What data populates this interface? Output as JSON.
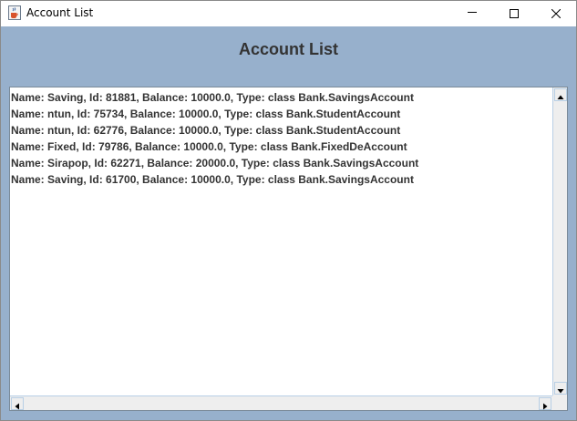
{
  "window": {
    "title": "Account List",
    "icon": "java-cup-icon",
    "controls": [
      "minimize",
      "maximize",
      "close"
    ]
  },
  "main": {
    "heading": "Account List",
    "accounts": [
      "Name: Saving, Id: 81881, Balance: 10000.0, Type: class Bank.SavingsAccount",
      "Name: ntun, Id: 75734, Balance: 10000.0, Type: class Bank.StudentAccount",
      "Name: ntun, Id: 62776, Balance: 10000.0, Type: class Bank.StudentAccount",
      "Name: Fixed, Id: 79786, Balance: 10000.0, Type: class Bank.FixedDeAccount",
      "Name: Sirapop, Id: 62271, Balance: 20000.0, Type: class Bank.SavingsAccount",
      "Name: Saving, Id: 61700, Balance: 10000.0, Type: class Bank.SavingsAccount"
    ]
  },
  "colors": {
    "content_background": "#97b0cc",
    "heading_text": "#333333",
    "list_text": "#333333",
    "list_background": "#ffffff"
  }
}
